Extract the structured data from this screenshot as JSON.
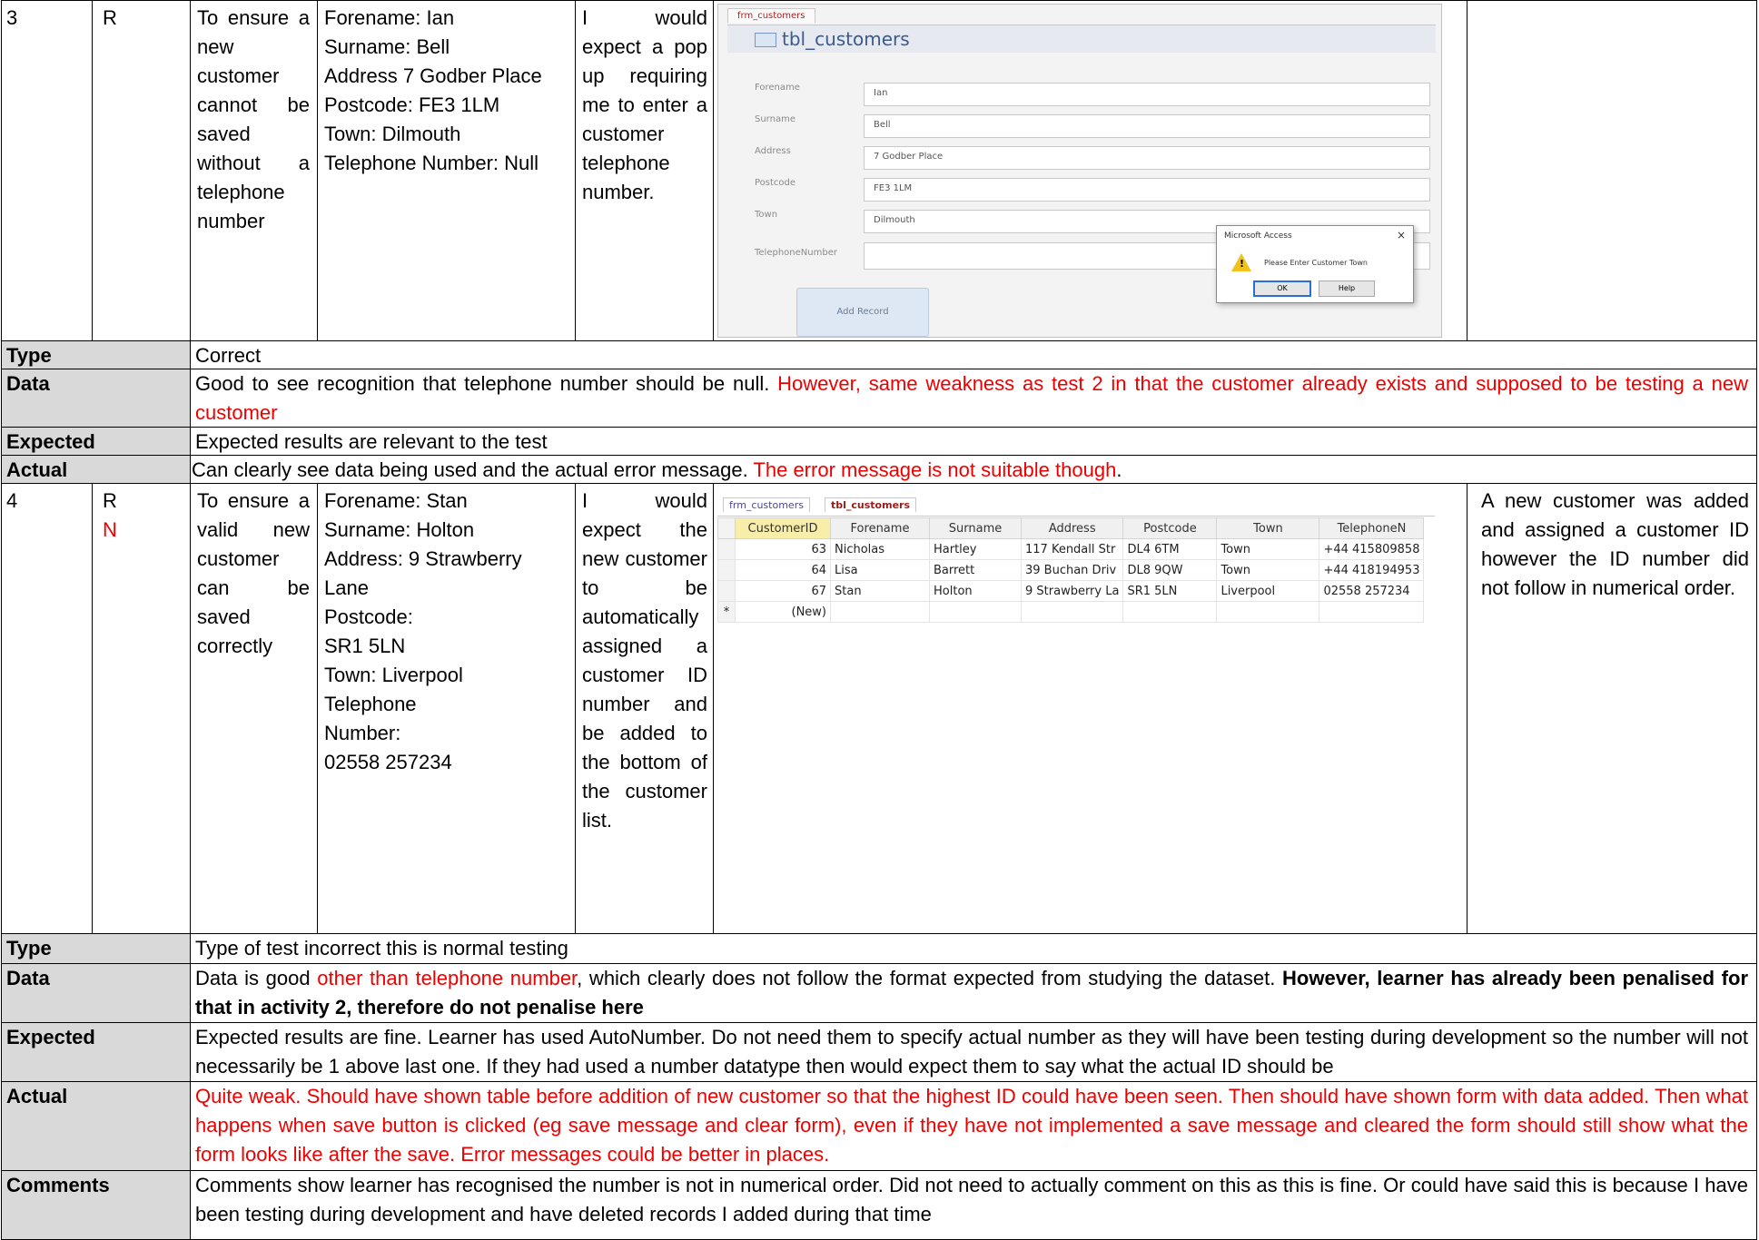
{
  "test3": {
    "num": "3",
    "type_letter": "R",
    "purpose": "To ensure a new customer cannot be saved without a telephone number",
    "data_lines": [
      "Forename: Ian",
      "Surname: Bell",
      "Address 7 Godber Place",
      "Postcode: FE3 1LM",
      "Town: Dilmouth",
      "Telephone Number: Null"
    ],
    "expected": "I would expect a pop up requiring me to enter a customer telephone number.",
    "screenshot": {
      "tab": "frm_customers",
      "title": "tbl_customers",
      "fields": [
        {
          "label": "Forename",
          "value": "Ian"
        },
        {
          "label": "Surname",
          "value": "Bell"
        },
        {
          "label": "Address",
          "value": "7 Godber Place"
        },
        {
          "label": "Postcode",
          "value": "FE3 1LM"
        },
        {
          "label": "Town",
          "value": "Dilmouth"
        },
        {
          "label": "TelephoneNumber",
          "value": ""
        }
      ],
      "button": "Add Record",
      "dialog": {
        "title": "Microsoft Access",
        "message": "Please Enter Customer Town",
        "ok": "OK",
        "help": "Help",
        "close": "×"
      }
    }
  },
  "feedback3": {
    "type_label": "Type",
    "type_text": "Correct",
    "data_label": "Data",
    "data_text": "Good to see recognition that telephone number should be null.",
    "data_red": "However, same weakness as test 2 in that the customer already exists and supposed to be testing a new customer",
    "expected_label": "Expected",
    "expected_text": "Expected results are relevant to the test",
    "actual_label": "Actual",
    "actual_text": "Can clearly see data being used and the actual error message.",
    "actual_red": "The error message is not suitable though",
    "actual_end": "."
  },
  "test4": {
    "num": "4",
    "type_letter": "R",
    "type_correction": "N",
    "purpose": "To ensure a valid new customer can be saved correctly",
    "data_lines": [
      "Forename: Stan",
      "Surname: Holton",
      "Address: 9 Strawberry Lane",
      "Postcode:",
      "SR1 5LN",
      "Town: Liverpool",
      "Telephone",
      "Number:",
      "02558 257234"
    ],
    "expected": "I would expect the new customer to be automatically assigned a customer ID number and be added to the bottom of the customer list.",
    "actual": "A new customer was added and assigned a customer ID however the ID number did not follow in numerical order.",
    "screenshot": {
      "tab1": "frm_customers",
      "tab2": "tbl_customers",
      "columns": [
        "CustomerID",
        "Forename",
        "Surname",
        "Address",
        "Postcode",
        "Town",
        "TelephoneN"
      ],
      "rows": [
        [
          "63",
          "Nicholas",
          "Hartley",
          "117 Kendall Str",
          "DL4 6TM",
          "Town",
          "+44 415809858"
        ],
        [
          "64",
          "Lisa",
          "Barrett",
          "39 Buchan Driv",
          "DL8 9QW",
          "Town",
          "+44 418194953"
        ],
        [
          "67",
          "Stan",
          "Holton",
          "9 Strawberry La",
          "SR1 5LN",
          "Liverpool",
          "02558 257234"
        ]
      ],
      "new_row": "(New)",
      "new_marker": "*"
    }
  },
  "feedback4": {
    "type_label": "Type",
    "type_text": "Type of test incorrect this is normal testing",
    "data_label": "Data",
    "data_a": "Data is good",
    "data_red": "other than telephone number",
    "data_b": ", which clearly does not follow the format expected from studying the dataset.",
    "data_bold": "However, learner has already been penalised for that in activity 2, therefore do not penalise here",
    "expected_label": "Expected",
    "expected_text": "Expected results are fine. Learner has used AutoNumber. Do not need them to specify actual number as they will have been testing during development so the number will not necessarily be 1 above last one. If they had used a number datatype then would expect them to say what the actual ID should be",
    "actual_label": "Actual",
    "actual_red": "Quite weak. Should have shown table before addition of new customer so that the highest ID could have been seen. Then should have shown form with data added. Then what happens when save button is clicked (eg save message and clear form), even if they have not implemented a save message and cleared the form should still show what the form looks like after the save. Error messages could be better in places.",
    "comments_label": "Comments",
    "comments_text": "Comments show learner has recognised the number is not in numerical order. Did not need to actually comment on this as this is fine. Or could have said this is because I have been testing during development and have deleted records I added during that time"
  },
  "colors": {
    "red": "#ee0000",
    "label_bg": "#d9d9d9"
  }
}
